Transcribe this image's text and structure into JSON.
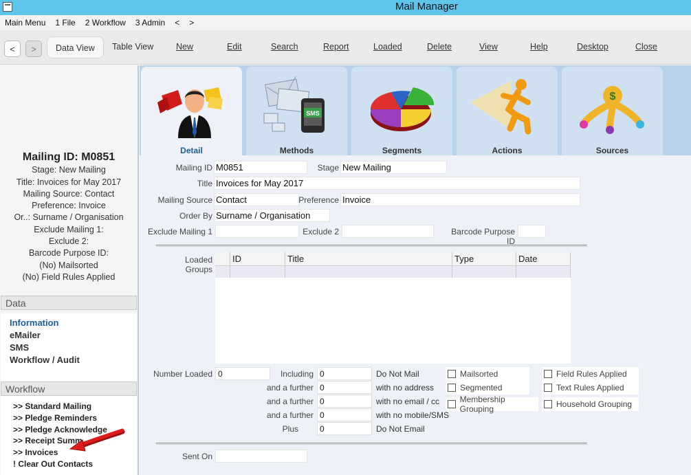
{
  "window": {
    "title": "Mail Manager"
  },
  "menu": [
    "Main Menu",
    "1 File",
    "2 Workflow",
    "3 Admin",
    "<",
    ">"
  ],
  "toolbar": {
    "back": "<",
    "forward": ">",
    "items": [
      "Data View",
      "Table View",
      "New",
      "Edit",
      "Search",
      "Report",
      "Loaded",
      "Delete",
      "View",
      "Help",
      "Desktop",
      "Close"
    ]
  },
  "summary": {
    "mailing_id": "Mailing ID: M0851",
    "lines": [
      "Stage: New Mailing",
      "Title: Invoices for May 2017",
      "Mailing Source: Contact",
      "Preference: Invoice",
      "Or..: Surname / Organisation",
      "Exclude Mailing 1:",
      "Exclude 2:",
      "Barcode Purpose ID:",
      "(No) Mailsorted",
      "(No) Field Rules Applied"
    ]
  },
  "data_section": {
    "header": "Data",
    "items": [
      "Information",
      "eMailer",
      "SMS",
      "Workflow / Audit"
    ]
  },
  "workflow_section": {
    "header": "Workflow",
    "items": [
      ">> Standard Mailing",
      ">> Pledge Reminders",
      ">> Pledge Acknowledge",
      ">> Receipt Summ",
      ">> Invoices",
      "! Clear Out Contacts"
    ]
  },
  "tabs": [
    "Detail",
    "Methods",
    "Segments",
    "Actions",
    "Sources"
  ],
  "form": {
    "mailing_id_label": "Mailing ID",
    "mailing_id": "M0851",
    "stage_label": "Stage",
    "stage": "New Mailing",
    "title_label": "Title",
    "title": "Invoices for May 2017",
    "source_label": "Mailing Source",
    "source": "Contact",
    "preference_label": "Preference",
    "preference": "Invoice",
    "order_label": "Order By",
    "order": "Surname / Organisation",
    "exclude1_label": "Exclude Mailing 1",
    "exclude1": "",
    "exclude2_label": "Exclude 2",
    "exclude2": "",
    "barcode_label": "Barcode Purpose ID",
    "barcode": ""
  },
  "loaded_groups": {
    "label": "Loaded Groups",
    "columns": [
      "ID",
      "Title",
      "Type",
      "Date"
    ]
  },
  "counts": {
    "number_loaded_label": "Number Loaded",
    "number_loaded": "0",
    "rows": [
      {
        "label": "Including",
        "value": "0",
        "desc": "Do Not Mail"
      },
      {
        "label": "and a further",
        "value": "0",
        "desc": "with no address"
      },
      {
        "label": "and a further",
        "value": "0",
        "desc": "with no email / cc"
      },
      {
        "label": "and a further",
        "value": "0",
        "desc": "with no mobile/SMS"
      },
      {
        "label": "Plus",
        "value": "0",
        "desc": "Do Not Email"
      }
    ]
  },
  "checks": {
    "mailsorted": "Mailsorted",
    "segmented": "Segmented",
    "membership": "Membership Grouping",
    "field_rules": "Field Rules Applied",
    "text_rules": "Text Rules Applied",
    "household": "Household Grouping"
  },
  "sent_on": {
    "label": "Sent On",
    "value": ""
  },
  "colors": {
    "titlebar": "#5ec4ea",
    "tab_strip": "#b8d2ea",
    "link_blue": "#1a5e9e",
    "arrow_red": "#e01b1b"
  }
}
